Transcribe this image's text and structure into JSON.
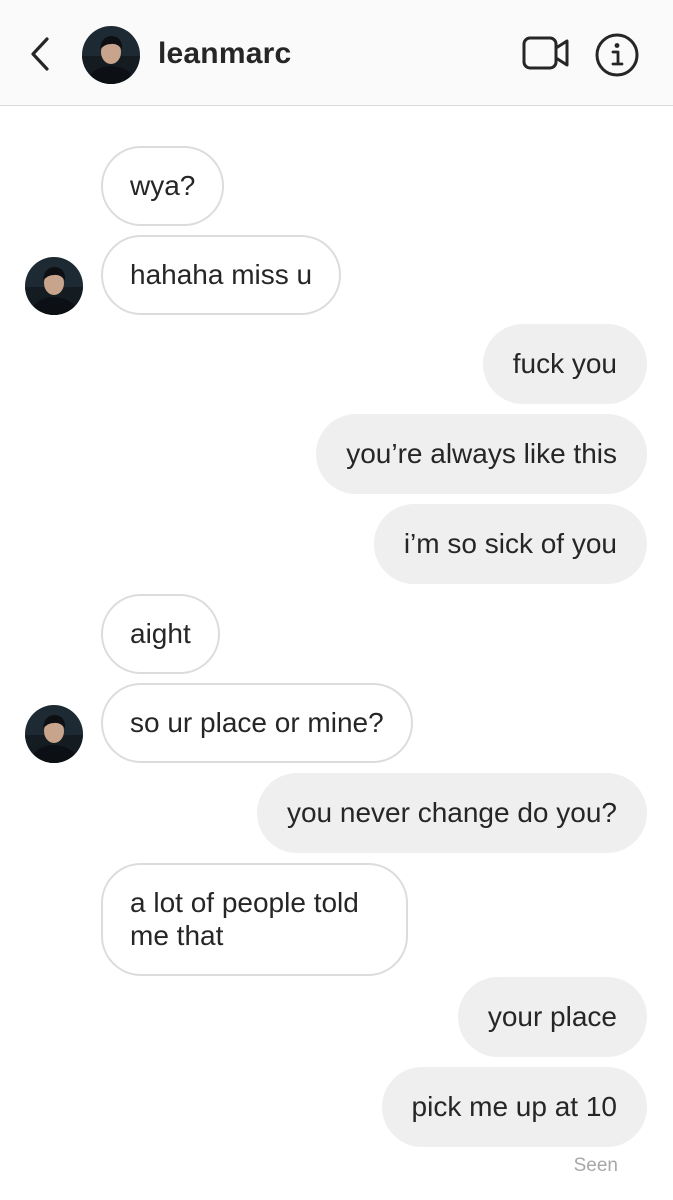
{
  "header": {
    "username": "leanmarc",
    "back_icon": "chevron-left-icon",
    "video_icon": "video-camera-icon",
    "info_icon": "info-icon"
  },
  "messages": [
    {
      "side": "in",
      "text": "wya?"
    },
    {
      "side": "in",
      "text": "hahaha miss u",
      "avatar": true
    },
    {
      "side": "out",
      "text": "fuck you"
    },
    {
      "side": "out",
      "text": "you’re always like this"
    },
    {
      "side": "out",
      "text": "i’m so sick of you"
    },
    {
      "side": "in",
      "text": "aight"
    },
    {
      "side": "in",
      "text": "so ur place or mine?",
      "avatar": true
    },
    {
      "side": "out",
      "text": "you never change do you?"
    },
    {
      "side": "in",
      "text": "a lot of people told me that"
    },
    {
      "side": "out",
      "text": "your place"
    },
    {
      "side": "out",
      "text": "pick me up at 10"
    }
  ],
  "status": "Seen",
  "colors": {
    "header_bg": "#fafafa",
    "incoming_bubble_bg": "#ffffff",
    "incoming_bubble_border": "#dcdcdc",
    "outgoing_bubble_bg": "#efefef",
    "text": "#262626",
    "seen_text": "#a8a8a8"
  }
}
